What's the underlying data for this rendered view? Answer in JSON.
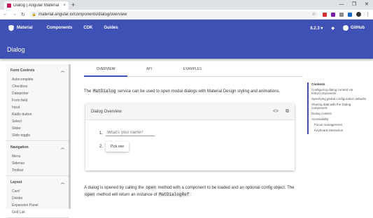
{
  "browser": {
    "tab_title": "Dialog | Angular Material",
    "tab_close": "×",
    "new_tab": "+",
    "win_min": "—",
    "win_max": "❐",
    "win_close": "✕",
    "url": "material.angular.io/components/dialog/overview"
  },
  "appbar": {
    "logo_label": "Material",
    "nav": [
      "Components",
      "CDK",
      "Guides"
    ],
    "version": "8.2.3",
    "github": "GitHub"
  },
  "header": {
    "title": "Dialog"
  },
  "sidenav": {
    "sections": [
      {
        "title": "Form Controls",
        "items": [
          "Autocomplete",
          "Checkbox",
          "Datepicker",
          "Form field",
          "Input",
          "Radio button",
          "Select",
          "Slider",
          "Slide toggle"
        ]
      },
      {
        "title": "Navigation",
        "items": [
          "Menu",
          "Sidenav",
          "Toolbar"
        ]
      },
      {
        "title": "Layout",
        "items": [
          "Card",
          "Divider",
          "Expansion Panel",
          "Grid List"
        ]
      }
    ]
  },
  "tabs": [
    "OVERVIEW",
    "API",
    "EXAMPLES"
  ],
  "intro": {
    "pre": "The ",
    "code": "MatDialog",
    "post": " service can be used to open modal dialogs with Material Design styling and animations."
  },
  "example": {
    "title": "Dialog Overview",
    "code_icon": "<>",
    "open_icon": "⧉",
    "placeholder": "What's your name?",
    "num1": "1.",
    "num2": "2.",
    "button": "Pick one"
  },
  "para2": {
    "t1": "A dialog is opened by calling the ",
    "c1": "open",
    "t2": " method with a component to be loaded and an optional config object. The ",
    "c2": "open",
    "t3": " method will return an instance of ",
    "c3": "MatDialogRef",
    "t4": ":"
  },
  "toc": {
    "title": "Contents",
    "items": [
      {
        "label": "Configuring dialog content via entryComponents",
        "sub": false
      },
      {
        "label": "Specifying global configuration defaults",
        "sub": false
      },
      {
        "label": "Sharing data with the Dialog component.",
        "sub": false
      },
      {
        "label": "Dialog content",
        "sub": false
      },
      {
        "label": "Accessibility",
        "sub": false
      },
      {
        "label": "Focus management",
        "sub": true
      },
      {
        "label": "Keyboard interaction",
        "sub": true
      }
    ]
  }
}
